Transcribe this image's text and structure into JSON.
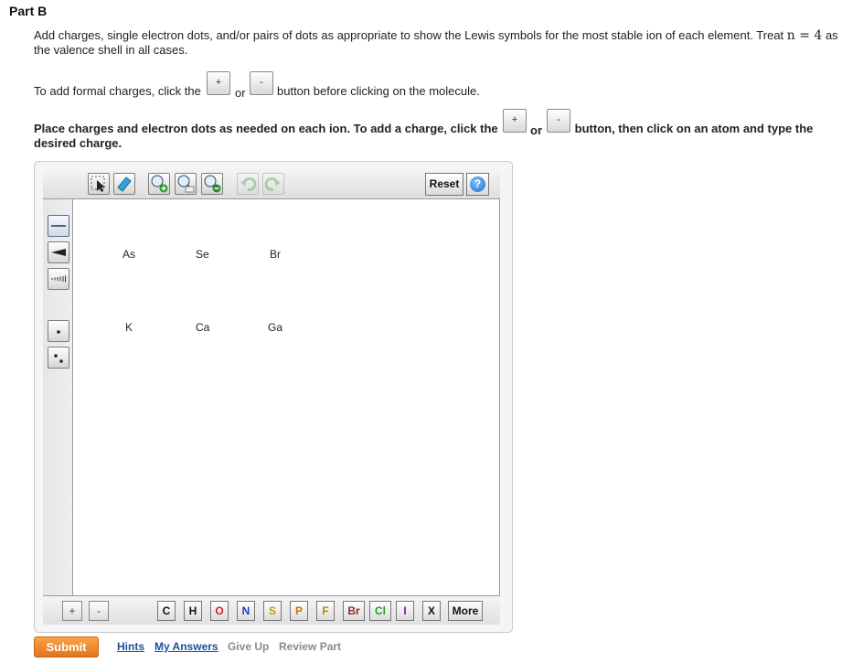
{
  "part_title": "Part B",
  "instructions": {
    "p1_before": "Add charges, single electron dots, and/or pairs of dots as appropriate to show the Lewis symbols for the most stable ion of each element. Treat ",
    "p1_math": "n = 4",
    "p1_after": " as the valence shell in all cases.",
    "p2_before": "To add formal charges, click the",
    "p2_or": "or",
    "p2_after": "button before clicking on the molecule.",
    "p3_before": "Place charges and electron dots as needed on each ion. To add a charge, click the",
    "p3_or": "or",
    "p3_after": "button, then click on an atom and type the desired charge.",
    "plus": "+",
    "minus": "-"
  },
  "toolbar": {
    "reset_label": "Reset",
    "help_label": "?"
  },
  "atoms": [
    {
      "symbol": "As"
    },
    {
      "symbol": "Se"
    },
    {
      "symbol": "Br"
    },
    {
      "symbol": "K"
    },
    {
      "symbol": "Ca"
    },
    {
      "symbol": "Ga"
    }
  ],
  "bottombar": {
    "plus": "+",
    "minus": "-",
    "elements": [
      {
        "symbol": "C",
        "color": "#111111"
      },
      {
        "symbol": "H",
        "color": "#111111"
      },
      {
        "symbol": "O",
        "color": "#e02020"
      },
      {
        "symbol": "N",
        "color": "#2040c0"
      },
      {
        "symbol": "S",
        "color": "#b8a000"
      },
      {
        "symbol": "P",
        "color": "#d07000"
      },
      {
        "symbol": "F",
        "color": "#b09000"
      },
      {
        "symbol": "Br",
        "color": "#8a2a2a"
      },
      {
        "symbol": "Cl",
        "color": "#20a020"
      },
      {
        "symbol": "I",
        "color": "#8020a0"
      },
      {
        "symbol": "X",
        "color": "#111111"
      }
    ],
    "more_label": "More"
  },
  "actions": {
    "submit_label": "Submit",
    "hints_label": "Hints",
    "my_answers_label": "My Answers",
    "give_up_label": "Give Up",
    "review_part_label": "Review Part"
  },
  "colors": {
    "submit": "#e8801f",
    "link": "#1a4fa3",
    "disabled_link": "#8a8a8a"
  }
}
